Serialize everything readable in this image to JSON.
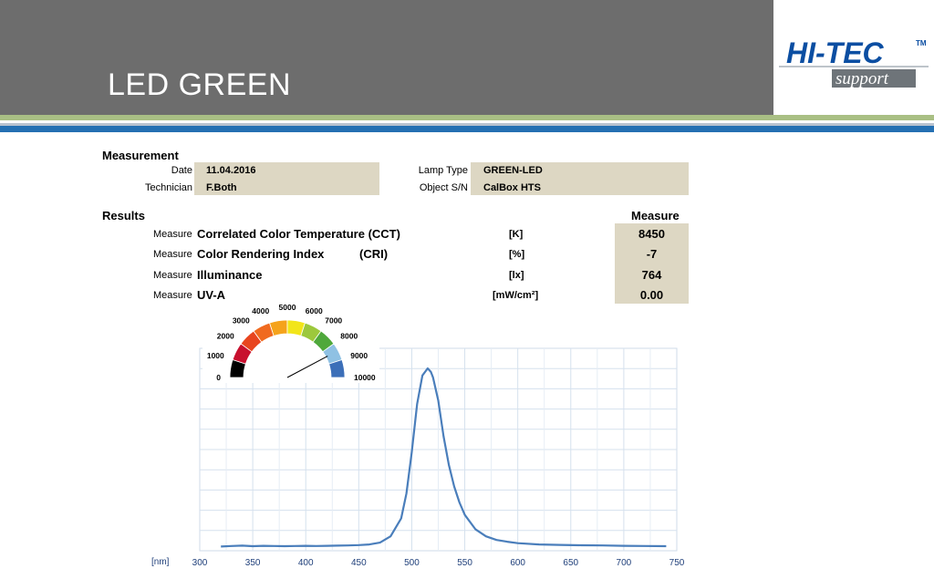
{
  "title": "LED GREEN",
  "logo": {
    "main": "HI-TEC",
    "tm": "TM",
    "sub": "support"
  },
  "measurement": {
    "heading": "Measurement",
    "date_label": "Date",
    "date_value": "11.04.2016",
    "technician_label": "Technician",
    "technician_value": "F.Both",
    "lamp_type_label": "Lamp Type",
    "lamp_type_value": "GREEN-LED",
    "object_sn_label": "Object S/N",
    "object_sn_value": "CalBox HTS"
  },
  "results": {
    "heading": "Results",
    "measure_heading": "Measure",
    "rows": [
      {
        "prefix": "Measure",
        "name": "Correlated Color Temperature (CCT)",
        "unit": "[K]",
        "value": "8450"
      },
      {
        "prefix": "Measure",
        "name": "Color Rendering Index",
        "abbr": "(CRI)",
        "unit": "[%]",
        "value": "-7"
      },
      {
        "prefix": "Measure",
        "name": "Illuminance",
        "unit": "[lx]",
        "value": "764"
      },
      {
        "prefix": "Measure",
        "name": "UV-A",
        "unit": "[mW/cm²]",
        "value": "0.00"
      }
    ]
  },
  "gauge": {
    "labels": [
      "0",
      "1000",
      "2000",
      "3000",
      "4000",
      "5000",
      "6000",
      "7000",
      "8000",
      "9000",
      "10000"
    ],
    "value": 8450,
    "colors": {
      "c1000": "#000000",
      "c2000": "#c8102e",
      "c3000": "#e8451e",
      "c4000": "#f06a1f",
      "c5000": "#f5a31c",
      "c6000": "#f2e51a",
      "c7000": "#9cc83c",
      "c8000": "#4fa83b",
      "c9000": "#8fc1e3",
      "c10000": "#3c6fb8"
    }
  },
  "chart_data": {
    "type": "line",
    "xlabel": "[nm]",
    "xlim": [
      300,
      750
    ],
    "x_ticks": [
      "300",
      "350",
      "400",
      "450",
      "500",
      "550",
      "600",
      "650",
      "700",
      "750"
    ],
    "series": [
      {
        "color": "#4a7ebb",
        "x": [
          320,
          330,
          340,
          350,
          360,
          370,
          380,
          390,
          400,
          410,
          420,
          430,
          440,
          450,
          460,
          470,
          480,
          490,
          495,
          500,
          505,
          510,
          515,
          518,
          520,
          525,
          530,
          535,
          540,
          545,
          550,
          560,
          570,
          580,
          590,
          600,
          620,
          640,
          660,
          680,
          700,
          720,
          740
        ],
        "y": [
          0.003,
          0.006,
          0.008,
          0.005,
          0.007,
          0.006,
          0.005,
          0.006,
          0.007,
          0.006,
          0.007,
          0.008,
          0.009,
          0.011,
          0.015,
          0.025,
          0.06,
          0.16,
          0.3,
          0.53,
          0.8,
          0.96,
          1.0,
          0.98,
          0.95,
          0.82,
          0.62,
          0.46,
          0.34,
          0.25,
          0.18,
          0.1,
          0.06,
          0.04,
          0.03,
          0.022,
          0.015,
          0.012,
          0.01,
          0.009,
          0.007,
          0.006,
          0.005
        ]
      }
    ],
    "grid": true
  }
}
